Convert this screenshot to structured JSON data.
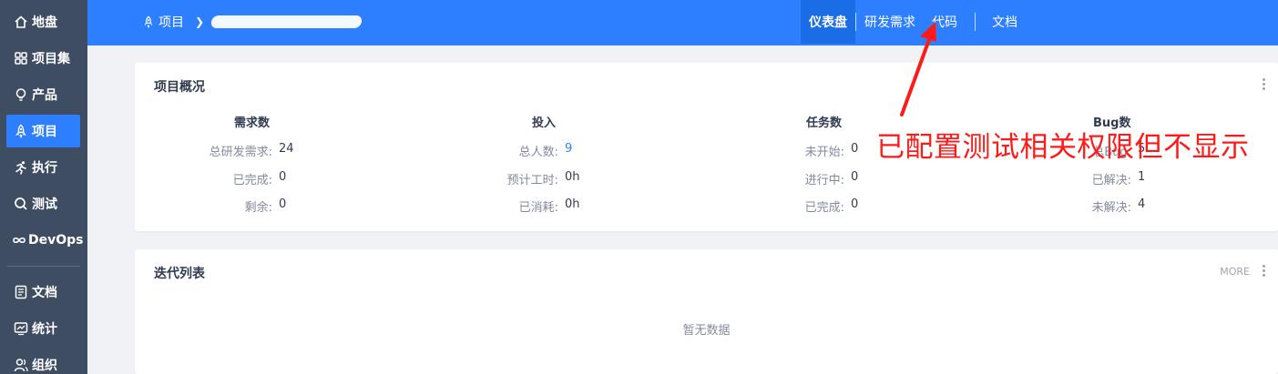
{
  "sidebar": {
    "items": [
      {
        "label": "地盘",
        "icon": "home-icon"
      },
      {
        "label": "项目集",
        "icon": "grid-icon"
      },
      {
        "label": "产品",
        "icon": "lightbulb-icon"
      },
      {
        "label": "项目",
        "icon": "rocket-icon",
        "active": true
      },
      {
        "label": "执行",
        "icon": "run-icon"
      },
      {
        "label": "测试",
        "icon": "magnifier-icon"
      },
      {
        "label": "DevOps",
        "icon": "infinity-icon"
      },
      {
        "label": "文档",
        "icon": "document-icon"
      },
      {
        "label": "统计",
        "icon": "chart-icon"
      },
      {
        "label": "组织",
        "icon": "users-icon"
      }
    ]
  },
  "header": {
    "breadcrumb_root": "项目",
    "nav": [
      {
        "label": "仪表盘",
        "active": true
      },
      {
        "label": "研发需求"
      },
      {
        "label": "代码"
      },
      {
        "label": "文档"
      }
    ]
  },
  "overview": {
    "title": "项目概况",
    "columns": [
      {
        "title": "需求数",
        "rows": [
          {
            "key": "总研发需求:",
            "value": "24"
          },
          {
            "key": "已完成:",
            "value": "0"
          },
          {
            "key": "剩余:",
            "value": "0"
          }
        ]
      },
      {
        "title": "投入",
        "rows": [
          {
            "key": "总人数:",
            "value": "9"
          },
          {
            "key": "预计工时:",
            "value": "0h"
          },
          {
            "key": "已消耗:",
            "value": "0h"
          }
        ]
      },
      {
        "title": "任务数",
        "rows": [
          {
            "key": "未开始:",
            "value": "0"
          },
          {
            "key": "进行中:",
            "value": "0"
          },
          {
            "key": "已完成:",
            "value": "0"
          }
        ]
      },
      {
        "title": "Bug数",
        "rows": [
          {
            "key": "总Bug:",
            "value": "5"
          },
          {
            "key": "已解决:",
            "value": "1"
          },
          {
            "key": "未解决:",
            "value": "4"
          }
        ]
      }
    ]
  },
  "iterations": {
    "title": "迭代列表",
    "more_label": "MORE",
    "empty_text": "暂无数据"
  },
  "annotation": {
    "text": "已配置测试相关权限但不显示",
    "color": "#ff1a1a"
  },
  "colors": {
    "sidebar_bg": "#3f4d63",
    "accent": "#2e7fff",
    "page_bg": "#f0f2f5"
  }
}
